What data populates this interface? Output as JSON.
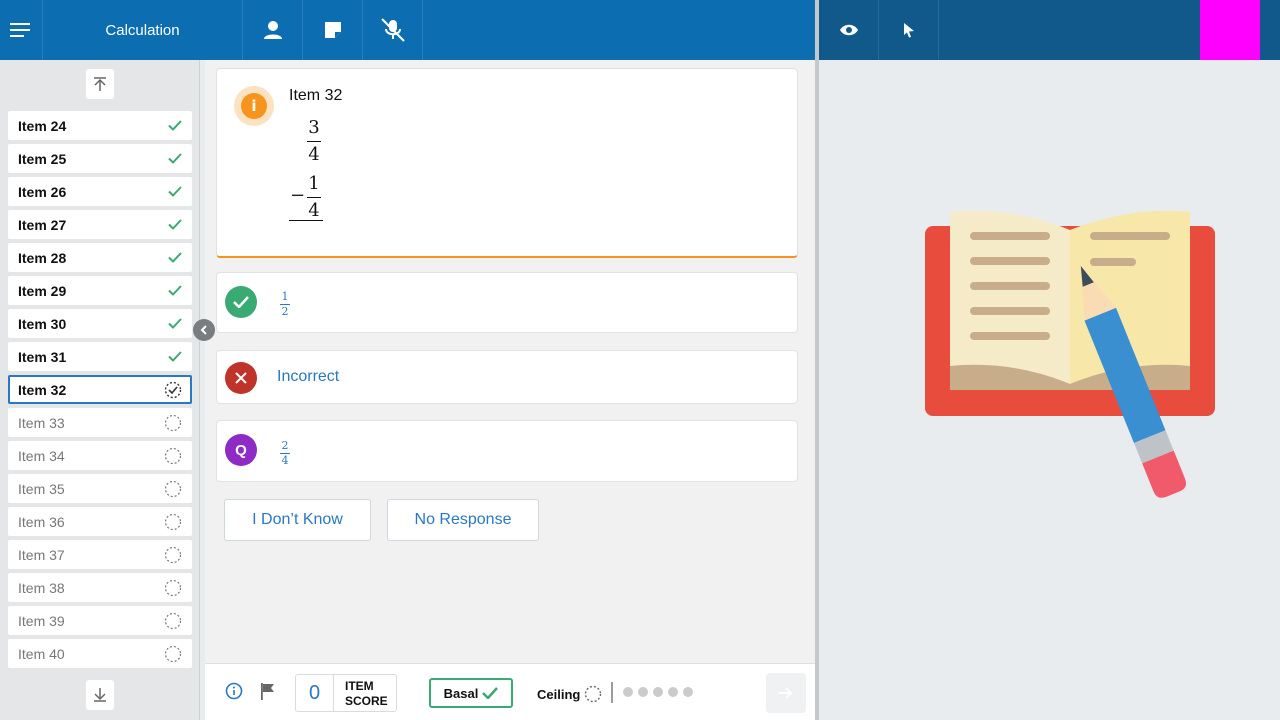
{
  "header": {
    "title": "Calculation",
    "icons": [
      "menu-icon",
      "person-icon",
      "note-icon",
      "mic-off-icon"
    ],
    "right_icons": [
      "eye-icon",
      "pointer-icon"
    ],
    "accent_color": "#ff00ff"
  },
  "sidebar": {
    "items": [
      {
        "label": "Item 24",
        "status": "done"
      },
      {
        "label": "Item 25",
        "status": "done"
      },
      {
        "label": "Item 26",
        "status": "done"
      },
      {
        "label": "Item 27",
        "status": "done"
      },
      {
        "label": "Item 28",
        "status": "done"
      },
      {
        "label": "Item 29",
        "status": "done"
      },
      {
        "label": "Item 30",
        "status": "done"
      },
      {
        "label": "Item 31",
        "status": "done"
      },
      {
        "label": "Item 32",
        "status": "active"
      },
      {
        "label": "Item 33",
        "status": "pending"
      },
      {
        "label": "Item 34",
        "status": "pending"
      },
      {
        "label": "Item 35",
        "status": "pending"
      },
      {
        "label": "Item 36",
        "status": "pending"
      },
      {
        "label": "Item 37",
        "status": "pending"
      },
      {
        "label": "Item 38",
        "status": "pending"
      },
      {
        "label": "Item 39",
        "status": "pending"
      },
      {
        "label": "Item 40",
        "status": "pending"
      }
    ]
  },
  "question": {
    "title": "Item 32",
    "operand1": {
      "num": "3",
      "den": "4"
    },
    "operator": "−",
    "operand2": {
      "num": "1",
      "den": "4"
    }
  },
  "answers": {
    "correct": {
      "num": "1",
      "den": "2",
      "icon": "check-icon"
    },
    "incorrect": {
      "label": "Incorrect",
      "icon": "x-icon"
    },
    "q": {
      "num": "2",
      "den": "4",
      "icon_letter": "Q"
    }
  },
  "buttons": {
    "dont_know": "I Don’t Know",
    "no_response": "No Response"
  },
  "footer": {
    "score_value": "0",
    "score_label_line1": "ITEM",
    "score_label_line2": "SCORE",
    "basal_label": "Basal",
    "ceiling_label": "Ceiling",
    "progress_dots": 5
  }
}
